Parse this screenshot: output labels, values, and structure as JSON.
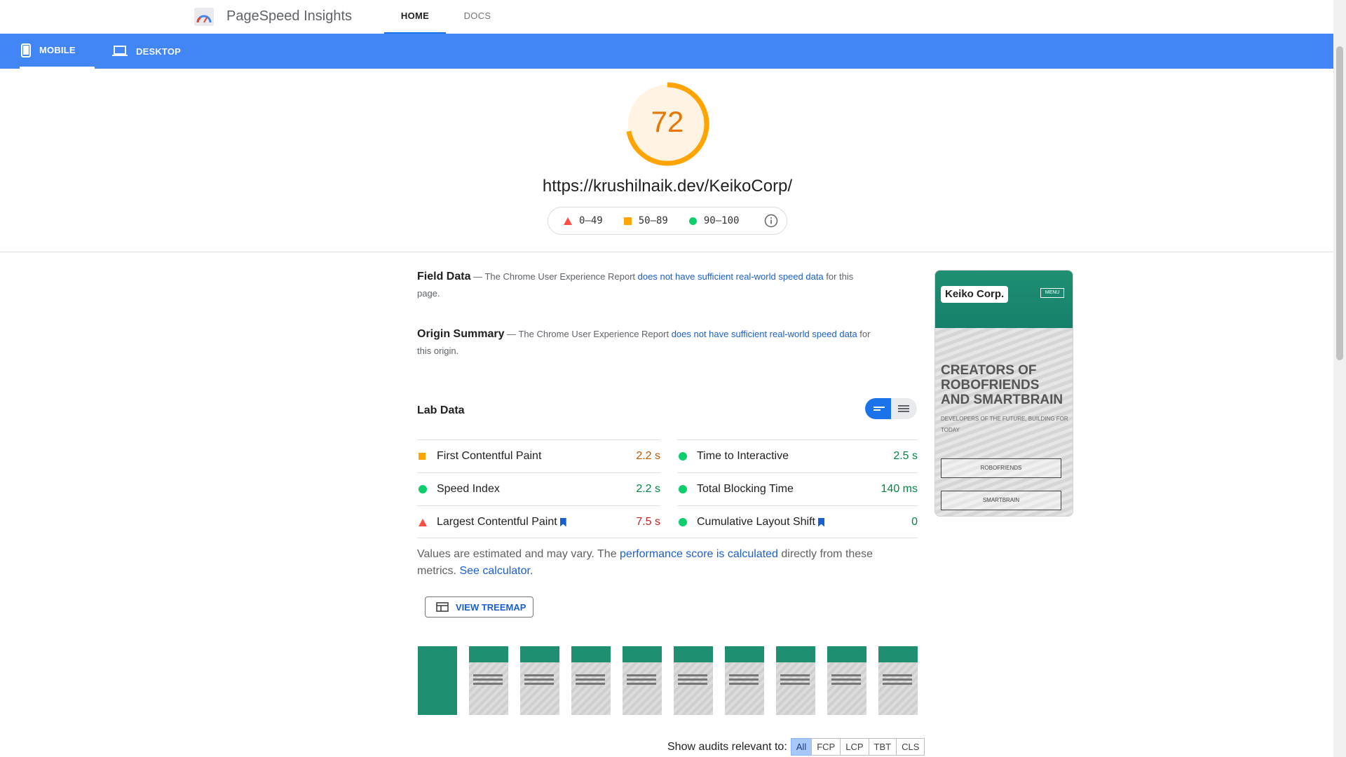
{
  "header": {
    "app_title": "PageSpeed Insights",
    "tabs": [
      {
        "label": "HOME"
      },
      {
        "label": "DOCS"
      }
    ]
  },
  "device_tabs": [
    {
      "label": "MOBILE",
      "icon": "smartphone-icon",
      "active": true
    },
    {
      "label": "DESKTOP",
      "icon": "laptop-icon",
      "active": false
    }
  ],
  "score": {
    "value": "72",
    "fraction": 0.72,
    "color": "#ffa400"
  },
  "url": "https://krushilnaik.dev/KeikoCorp/",
  "legend": [
    {
      "range": "0–49",
      "shape": "triangle",
      "color": "#ff4e42"
    },
    {
      "range": "50–89",
      "shape": "square",
      "color": "#ffa400"
    },
    {
      "range": "90–100",
      "shape": "circle",
      "color": "#0cce6b"
    }
  ],
  "field_data": {
    "title": "Field Data",
    "prefix": " — The Chrome User Experience Report ",
    "link": "does not have sufficient real-world speed data",
    "suffix": " for this page."
  },
  "origin_summary": {
    "title": "Origin Summary",
    "prefix": " — The Chrome User Experience Report ",
    "link": "does not have sufficient real-world speed data",
    "suffix": " for this origin."
  },
  "lab_data": {
    "title": "Lab Data",
    "metrics": [
      {
        "label": "First Contentful Paint",
        "value": "2.2 s",
        "status": "average",
        "bookmark": false
      },
      {
        "label": "Time to Interactive",
        "value": "2.5 s",
        "status": "pass",
        "bookmark": false
      },
      {
        "label": "Speed Index",
        "value": "2.2 s",
        "status": "pass",
        "bookmark": false
      },
      {
        "label": "Total Blocking Time",
        "value": "140 ms",
        "status": "pass",
        "bookmark": false
      },
      {
        "label": "Largest Contentful Paint",
        "value": "7.5 s",
        "status": "fail",
        "bookmark": true
      },
      {
        "label": "Cumulative Layout Shift",
        "value": "0",
        "status": "pass",
        "bookmark": true
      }
    ],
    "note_prefix": "Values are estimated and may vary. The ",
    "note_link": "performance score is calculated",
    "note_mid": " directly from these metrics. ",
    "note_link2": "See calculator.",
    "treemap_button": "VIEW TREEMAP"
  },
  "thumbnail": {
    "logo": "Keiko Corp.",
    "menu": "MENU",
    "heading": "CREATORS OF ROBOFRIENDS AND SMARTBRAIN",
    "subheading": "DEVELOPERS OF THE FUTURE, BUILDING FOR TODAY",
    "button1": "ROBOFRIENDS",
    "button2": "SMARTBRAIN"
  },
  "filmstrip_count": 10,
  "audit_filter": {
    "label": "Show audits relevant to:",
    "options": [
      "All",
      "FCP",
      "LCP",
      "TBT",
      "CLS"
    ],
    "active": "All"
  }
}
